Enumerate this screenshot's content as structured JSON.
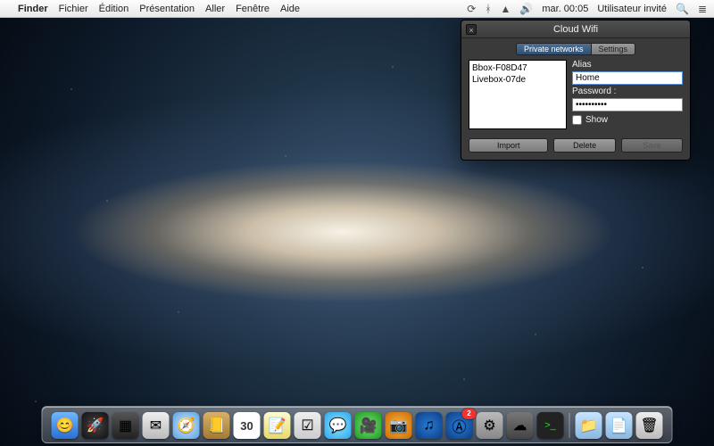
{
  "menubar": {
    "app": "Finder",
    "items": [
      "Fichier",
      "Édition",
      "Présentation",
      "Aller",
      "Fenêtre",
      "Aide"
    ],
    "clock": "mar. 00:05",
    "user": "Utilisateur invité"
  },
  "panel": {
    "title": "Cloud Wifi",
    "tabs": {
      "private": "Private networks",
      "settings": "Settings"
    },
    "networks": [
      "Bbox-F08D47",
      "Livebox-07de"
    ],
    "alias_label": "Alias",
    "alias_value": "Home",
    "password_label": "Password :",
    "password_value": "••••••••••",
    "show_label": "Show",
    "buttons": {
      "import": "Import",
      "delete": "Delete",
      "save": "Save"
    }
  },
  "dock": {
    "calendar_day": "30",
    "appstore_badge": "2",
    "items": [
      {
        "name": "finder",
        "glyph": "😊"
      },
      {
        "name": "launchpad",
        "glyph": "🚀"
      },
      {
        "name": "mission-control",
        "glyph": "▦"
      },
      {
        "name": "mail",
        "glyph": "✉︎"
      },
      {
        "name": "safari",
        "glyph": "🧭"
      },
      {
        "name": "contacts",
        "glyph": "📒"
      },
      {
        "name": "calendar",
        "glyph": ""
      },
      {
        "name": "notes",
        "glyph": "📝"
      },
      {
        "name": "reminders",
        "glyph": "☑︎"
      },
      {
        "name": "messages",
        "glyph": "💬"
      },
      {
        "name": "facetime",
        "glyph": "🎥"
      },
      {
        "name": "photo-booth",
        "glyph": "📷"
      },
      {
        "name": "itunes",
        "glyph": "♫"
      },
      {
        "name": "app-store",
        "glyph": "Ⓐ"
      },
      {
        "name": "system-preferences",
        "glyph": "⚙︎"
      },
      {
        "name": "cloud-wifi",
        "glyph": "☁︎"
      },
      {
        "name": "terminal",
        "glyph": ">_"
      }
    ]
  }
}
